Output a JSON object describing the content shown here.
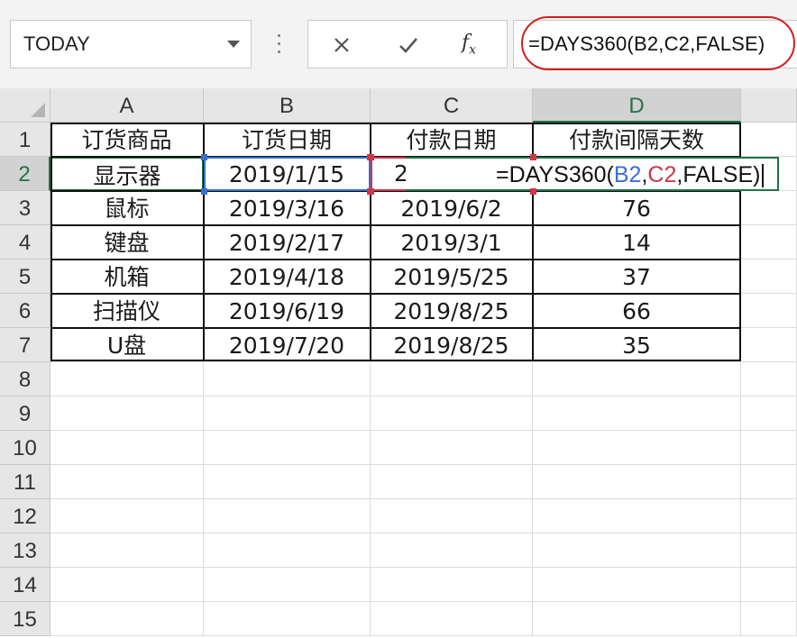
{
  "formula_bar": {
    "name_box": "TODAY",
    "fx_label": "fx",
    "formula": "=DAYS360(B2,C2,FALSE)"
  },
  "columns": [
    "A",
    "B",
    "C",
    "D"
  ],
  "rows": [
    "1",
    "2",
    "3",
    "4",
    "5",
    "6",
    "7",
    "8",
    "9",
    "10",
    "11",
    "12",
    "13",
    "14",
    "15"
  ],
  "table": {
    "headers": [
      "订货商品",
      "订货日期",
      "付款日期",
      "付款间隔天数"
    ],
    "data": [
      [
        "显示器",
        "2019/1/15",
        "",
        ""
      ],
      [
        "鼠标",
        "2019/3/16",
        "2019/6/2",
        "76"
      ],
      [
        "键盘",
        "2019/2/17",
        "2019/3/1",
        "14"
      ],
      [
        "机箱",
        "2019/4/18",
        "2019/5/25",
        "37"
      ],
      [
        "扫描仪",
        "2019/6/19",
        "2019/8/25",
        "66"
      ],
      [
        "U盘",
        "2019/7/20",
        "2019/8/25",
        "35"
      ]
    ]
  },
  "c2_peek": "2",
  "in_cell_editor": {
    "prefix": "=DAYS360(",
    "ref_b": "B2",
    "sep1": ",",
    "ref_c": "C2",
    "suffix": ",FALSE)"
  },
  "colors": {
    "ref_b": "#3a6fd0",
    "ref_c": "#d0354a",
    "active": "#217346",
    "annotation": "#d02020"
  },
  "icons": [
    "dropdown-arrow-icon",
    "cancel-icon",
    "enter-icon",
    "insert-function-icon"
  ]
}
